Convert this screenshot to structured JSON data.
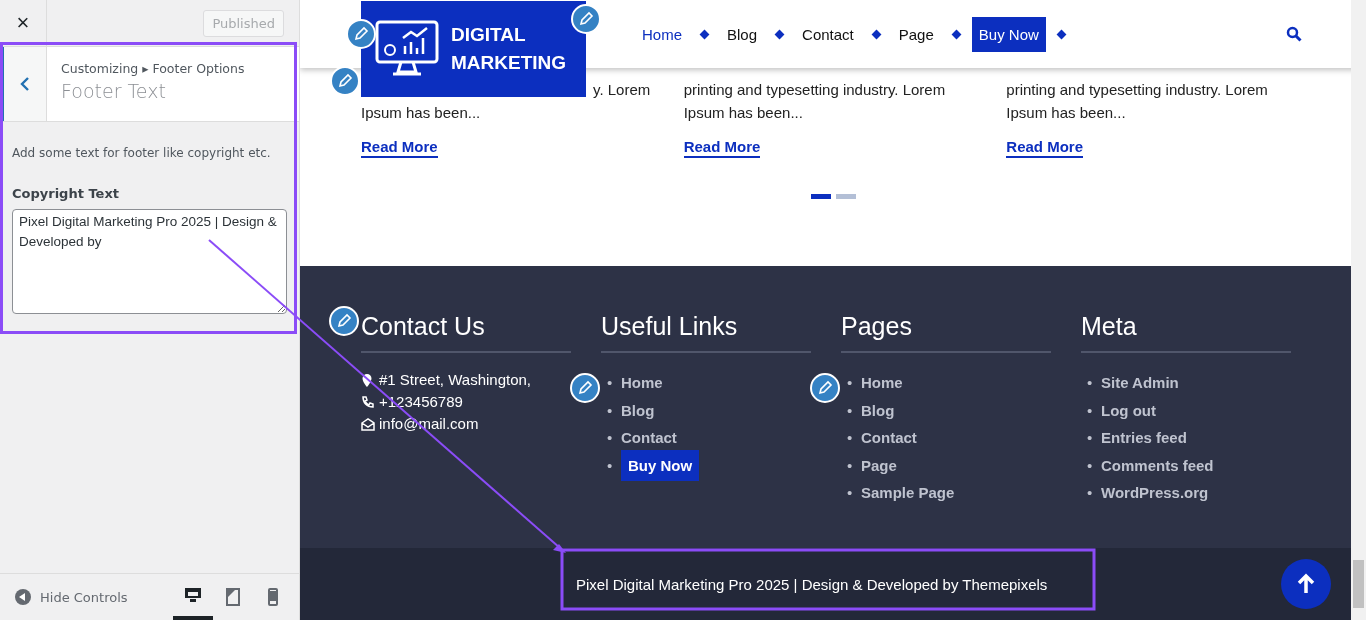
{
  "customizer": {
    "close": "×",
    "publish_button": {
      "label": "Published",
      "disabled": true
    },
    "breadcrumb": "Customizing ▸ Footer Options",
    "section_title": "Footer Text",
    "description": "Add some text for footer like copyright etc.",
    "field_label": "Copyright Text",
    "field_value": "Pixel Digital Marketing Pro 2025 | Design & Developed by",
    "hide_controls": "Hide Controls",
    "devices": [
      {
        "kind": "desktop",
        "selected": true
      },
      {
        "kind": "tablet",
        "selected": false
      },
      {
        "kind": "mobile",
        "selected": false
      }
    ]
  },
  "header": {
    "logo_lines": [
      "DIGITAL",
      "MARKETING"
    ],
    "nav": [
      {
        "label": "Home",
        "selected": true,
        "kind": "link"
      },
      {
        "label": "Blog",
        "selected": false,
        "kind": "link"
      },
      {
        "label": "Contact",
        "selected": false,
        "kind": "link"
      },
      {
        "label": "Page",
        "selected": false,
        "kind": "link"
      },
      {
        "label": "Buy Now",
        "selected": false,
        "kind": "button"
      }
    ]
  },
  "posts": [
    {
      "lines": [
        "y. Lorem",
        "Ipsum has been..."
      ],
      "read_more": "Read More"
    },
    {
      "lines": [
        "printing and typesetting industry. Lorem",
        "Ipsum has been..."
      ],
      "read_more": "Read More"
    },
    {
      "lines": [
        "printing and typesetting industry. Lorem",
        "Ipsum has been..."
      ],
      "read_more": "Read More"
    }
  ],
  "slider_dots": [
    {
      "selected": true
    },
    {
      "selected": false
    }
  ],
  "footer": {
    "contact": {
      "title": "Contact Us",
      "items": [
        {
          "kind": "pin",
          "text": "#1 Street, Washington,"
        },
        {
          "kind": "phone",
          "text": "+123456789"
        },
        {
          "kind": "mail",
          "text": "info@mail.com"
        }
      ]
    },
    "bullet": "•",
    "useful_links": {
      "title": "Useful Links",
      "items": [
        {
          "label": "Home",
          "kind": "link"
        },
        {
          "label": "Blog",
          "kind": "link"
        },
        {
          "label": "Contact",
          "kind": "link"
        },
        {
          "label": "Buy Now",
          "kind": "button"
        }
      ]
    },
    "pages": {
      "title": "Pages",
      "items": [
        "Home",
        "Blog",
        "Contact",
        "Page",
        "Sample Page"
      ]
    },
    "meta": {
      "title": "Meta",
      "items": [
        "Site Admin",
        "Log out",
        "Entries feed",
        "Comments feed",
        "WordPress.org"
      ]
    },
    "copyright": "Pixel Digital Marketing Pro 2025 | Design & Developed by Themepixels"
  }
}
